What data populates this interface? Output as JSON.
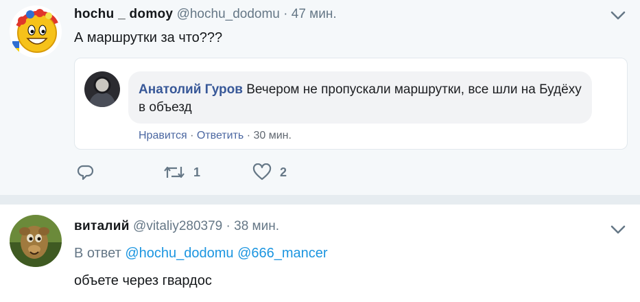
{
  "tweet1": {
    "name": "hochu _ domoy",
    "handle": "@hochu_dodomu",
    "separator": "·",
    "time": "47 мин.",
    "text": "А маршрутки за что???",
    "embed": {
      "author": "Анатолий Гуров",
      "comment": "Вечером не пропускали маршрутки, все шли на Будёху в объезд",
      "like_label": "Нравится",
      "sep": "·",
      "reply_label": "Ответить",
      "time": "30 мин."
    },
    "actions": {
      "replies": "",
      "retweets": "1",
      "likes": "2"
    }
  },
  "tweet2": {
    "name": "виталий",
    "handle": "@vitaliy280379",
    "separator": "·",
    "time": "38 мин.",
    "reply_prefix": "В ответ",
    "mention1": "@hochu_dodomu",
    "mention2": "@666_mancer",
    "text": "объете через гвардос"
  },
  "icons": {
    "reply": "reply-icon",
    "retweet": "retweet-icon",
    "like": "heart-icon",
    "menu": "chevron-down-icon"
  },
  "colors": {
    "accent": "#1b95e0",
    "muted": "#657786",
    "fb_author": "#385898",
    "fb_link": "#4b67a1"
  }
}
